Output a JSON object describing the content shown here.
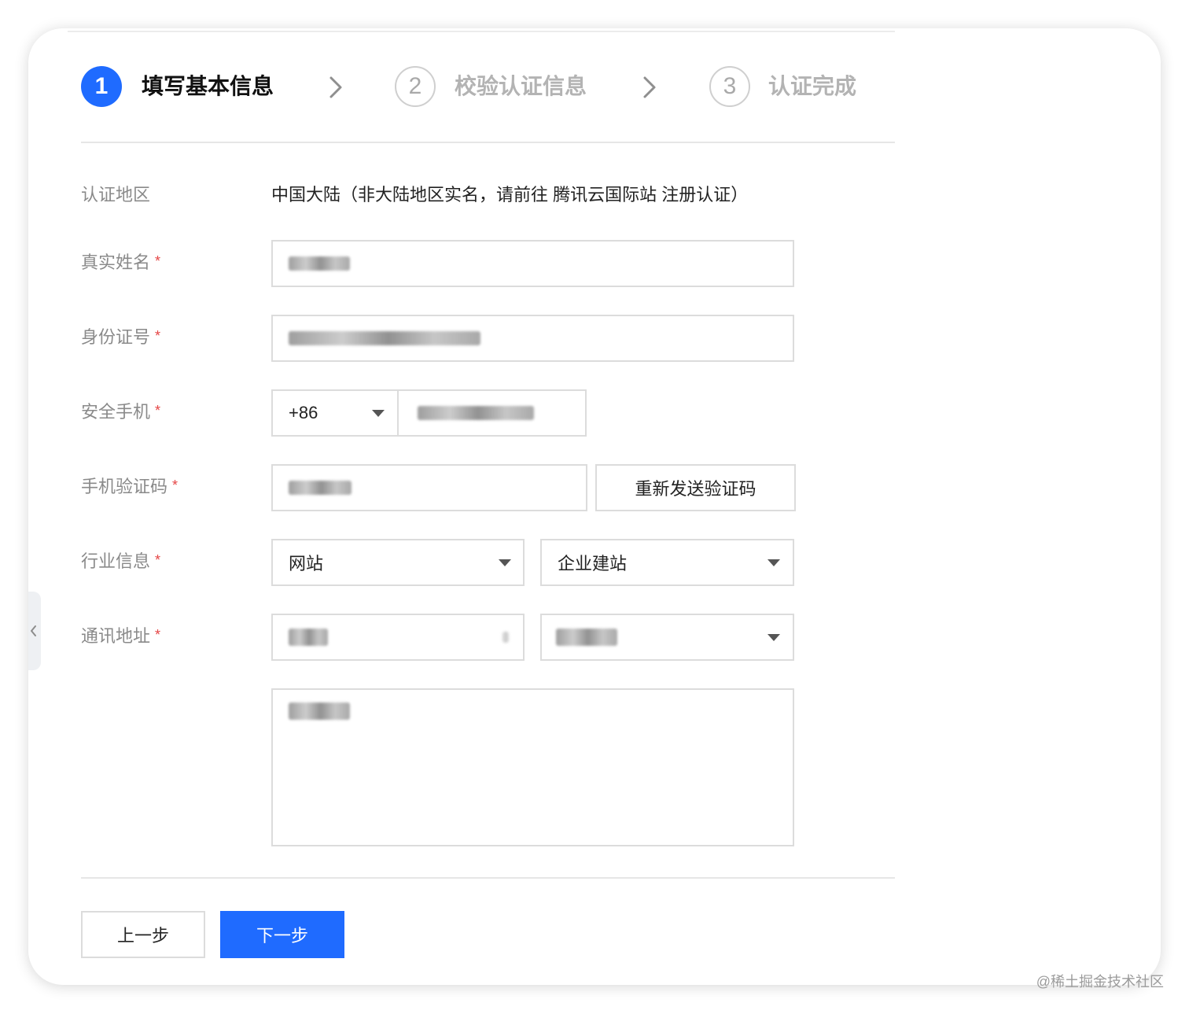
{
  "steps": [
    {
      "number": "1",
      "label": "填写基本信息",
      "state": "active"
    },
    {
      "number": "2",
      "label": "校验认证信息",
      "state": "inactive"
    },
    {
      "number": "3",
      "label": "认证完成",
      "state": "inactive"
    }
  ],
  "form": {
    "region": {
      "label": "认证地区",
      "value": "中国大陆（非大陆地区实名，请前往 腾讯云国际站 注册认证）"
    },
    "real_name": {
      "label": "真实姓名",
      "required_mark": "*"
    },
    "id_number": {
      "label": "身份证号",
      "required_mark": "*"
    },
    "phone": {
      "label": "安全手机",
      "required_mark": "*",
      "country_code": "+86"
    },
    "sms_code": {
      "label": "手机验证码",
      "required_mark": "*",
      "resend_label": "重新发送验证码"
    },
    "industry": {
      "label": "行业信息",
      "required_mark": "*",
      "primary": "网站",
      "secondary": "企业建站"
    },
    "address": {
      "label": "通讯地址",
      "required_mark": "*"
    }
  },
  "actions": {
    "prev_label": "上一步",
    "next_label": "下一步"
  },
  "watermark": "@稀土掘金技术社区",
  "colors": {
    "primary": "#1f6bff",
    "required": "#e54545",
    "border": "#dcdcdc"
  }
}
